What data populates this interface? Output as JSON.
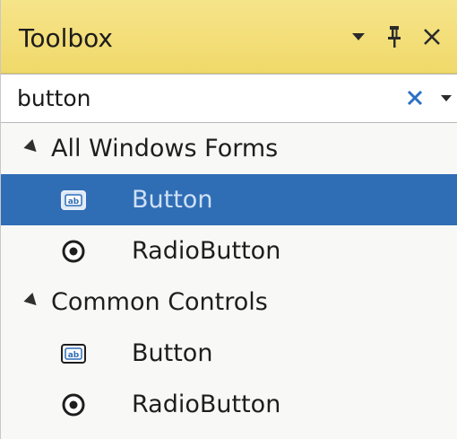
{
  "panel": {
    "title": "Toolbox",
    "controls": [
      "chevron-down-icon",
      "pin-icon",
      "close-icon"
    ]
  },
  "search": {
    "value": "button",
    "clear_icon": "clear-x-icon",
    "dropdown_icon": "chevron-down-icon"
  },
  "groups": [
    {
      "label": "All Windows Forms",
      "items": [
        {
          "label": "Button",
          "icon": "button-control-icon",
          "selected": true
        },
        {
          "label": "RadioButton",
          "icon": "radio-button-icon",
          "selected": false
        }
      ]
    },
    {
      "label": "Common Controls",
      "items": [
        {
          "label": "Button",
          "icon": "button-control-icon",
          "selected": false
        },
        {
          "label": "RadioButton",
          "icon": "radio-button-icon",
          "selected": false
        }
      ]
    }
  ],
  "colors": {
    "title_bar": "#f0d96a",
    "selection": "#2f6db5",
    "selection_text": "#cfe0f6",
    "clear_icon": "#2a6fc4"
  }
}
